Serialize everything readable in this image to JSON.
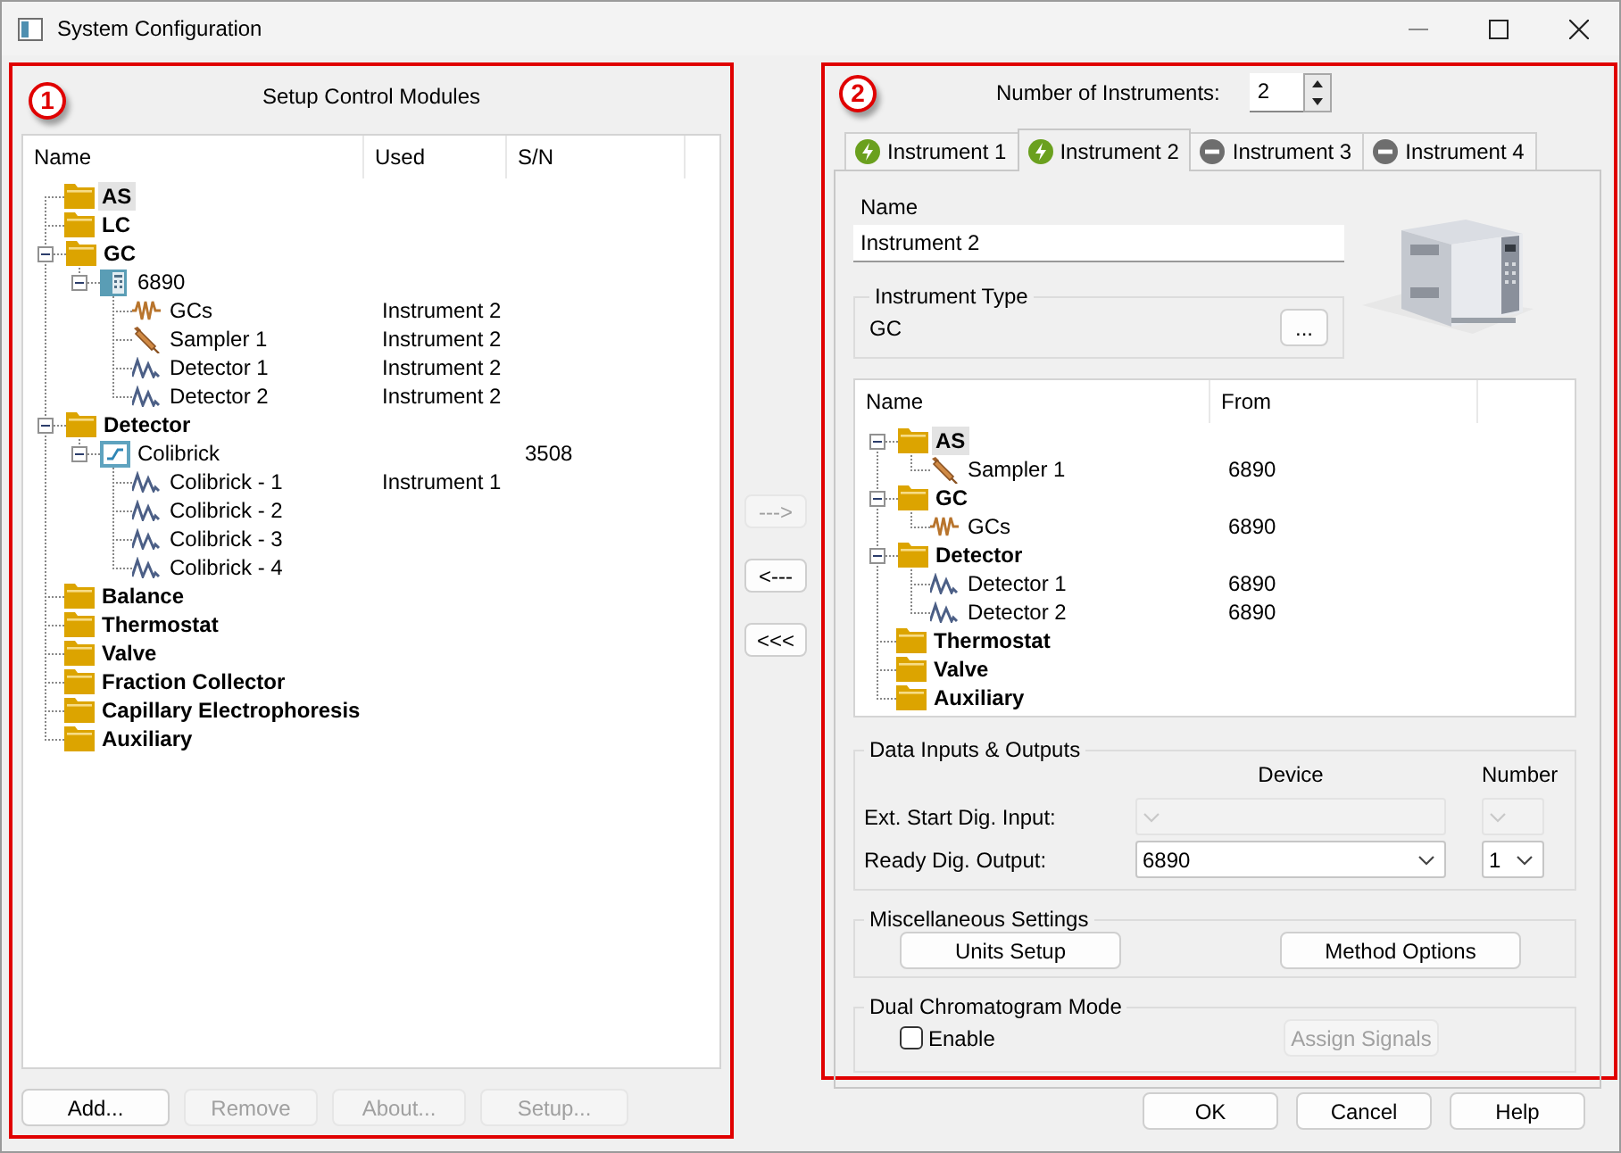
{
  "window": {
    "title": "System Configuration"
  },
  "modules_panel": {
    "badge": "1",
    "title": "Setup Control Modules",
    "columns": [
      "Name",
      "Used",
      "S/N"
    ],
    "tree": [
      {
        "label": "AS",
        "kind": "category",
        "selected": true
      },
      {
        "label": "LC",
        "kind": "category",
        "selected": false
      },
      {
        "label": "GC",
        "kind": "category",
        "selected": false,
        "expanded": true,
        "children": [
          {
            "label": "6890",
            "kind": "device",
            "selected": false,
            "expanded": true,
            "children": [
              {
                "label": "GCs",
                "kind": "gcs",
                "used": "Instrument 2",
                "selected": false
              },
              {
                "label": "Sampler 1",
                "kind": "sampler",
                "used": "Instrument 2",
                "selected": false
              },
              {
                "label": "Detector 1",
                "kind": "detector",
                "used": "Instrument 2",
                "selected": false
              },
              {
                "label": "Detector 2",
                "kind": "detector",
                "used": "Instrument 2",
                "selected": false
              }
            ]
          }
        ]
      },
      {
        "label": "Detector",
        "kind": "category",
        "selected": false,
        "expanded": true,
        "children": [
          {
            "label": "Colibrick",
            "kind": "signal_box",
            "sn": "3508",
            "selected": false,
            "expanded": true,
            "children": [
              {
                "label": "Colibrick - 1",
                "kind": "detector",
                "used": "Instrument 1",
                "selected": false
              },
              {
                "label": "Colibrick - 2",
                "kind": "detector",
                "selected": false
              },
              {
                "label": "Colibrick - 3",
                "kind": "detector",
                "selected": false
              },
              {
                "label": "Colibrick - 4",
                "kind": "detector",
                "selected": false
              }
            ]
          }
        ]
      },
      {
        "label": "Balance",
        "kind": "category",
        "selected": false
      },
      {
        "label": "Thermostat",
        "kind": "category",
        "selected": false
      },
      {
        "label": "Valve",
        "kind": "category",
        "selected": false
      },
      {
        "label": "Fraction Collector",
        "kind": "category",
        "selected": false
      },
      {
        "label": "Capillary Electrophoresis",
        "kind": "category",
        "selected": false
      },
      {
        "label": "Auxiliary",
        "kind": "category",
        "selected": false
      }
    ],
    "buttons": [
      {
        "label": "Add...",
        "disabled": false
      },
      {
        "label": "Remove",
        "disabled": true
      },
      {
        "label": "About...",
        "disabled": true
      },
      {
        "label": "Setup...",
        "disabled": true
      }
    ]
  },
  "transfer_buttons": [
    {
      "label": "--->",
      "disabled": true
    },
    {
      "label": "<---",
      "disabled": false
    },
    {
      "label": "<<<",
      "disabled": false
    }
  ],
  "instruments_panel": {
    "badge": "2",
    "count_label": "Number of Instruments:",
    "count": "2",
    "tabs": [
      {
        "label": "Instrument 1",
        "kind": "ready",
        "selected": false
      },
      {
        "label": "Instrument 2",
        "kind": "ready",
        "selected": true
      },
      {
        "label": "Instrument 3",
        "kind": "inactive",
        "selected": false
      },
      {
        "label": "Instrument 4",
        "kind": "inactive",
        "selected": false
      }
    ],
    "name_label": "Name",
    "name": "Instrument 2",
    "type_group": "Instrument Type",
    "type": "GC",
    "type_button": "...",
    "columns": [
      "Name",
      "From"
    ],
    "tree": [
      {
        "label": "AS",
        "kind": "category",
        "selected": true,
        "expanded": true,
        "children": [
          {
            "label": "Sampler 1",
            "kind": "sampler",
            "from": "6890",
            "selected": false
          }
        ]
      },
      {
        "label": "GC",
        "kind": "category",
        "selected": false,
        "expanded": true,
        "children": [
          {
            "label": "GCs",
            "kind": "gcs",
            "from": "6890",
            "selected": false
          }
        ]
      },
      {
        "label": "Detector",
        "kind": "category",
        "selected": false,
        "expanded": true,
        "children": [
          {
            "label": "Detector 1",
            "kind": "detector",
            "from": "6890",
            "selected": false
          },
          {
            "label": "Detector 2",
            "kind": "detector",
            "from": "6890",
            "selected": false
          }
        ]
      },
      {
        "label": "Thermostat",
        "kind": "category",
        "selected": false
      },
      {
        "label": "Valve",
        "kind": "category",
        "selected": false
      },
      {
        "label": "Auxiliary",
        "kind": "category",
        "selected": false
      }
    ],
    "io": {
      "title": "Data Inputs & Outputs",
      "columns": [
        "Device",
        "Number"
      ],
      "rows": [
        {
          "label": "Ext. Start Dig. Input:",
          "disabled": true
        },
        {
          "label": "Ready Dig. Output:",
          "device": "6890",
          "number": "1",
          "disabled": false
        }
      ]
    },
    "misc": {
      "title": "Miscellaneous Settings",
      "buttons": [
        "Units Setup",
        "Method Options"
      ]
    },
    "dual": {
      "title": "Dual Chromatogram Mode",
      "checkbox": {
        "label": "Enable",
        "checked": false
      },
      "button": {
        "label": "Assign Signals",
        "disabled": true
      }
    }
  },
  "dialog_buttons": [
    "OK",
    "Cancel",
    "Help"
  ]
}
